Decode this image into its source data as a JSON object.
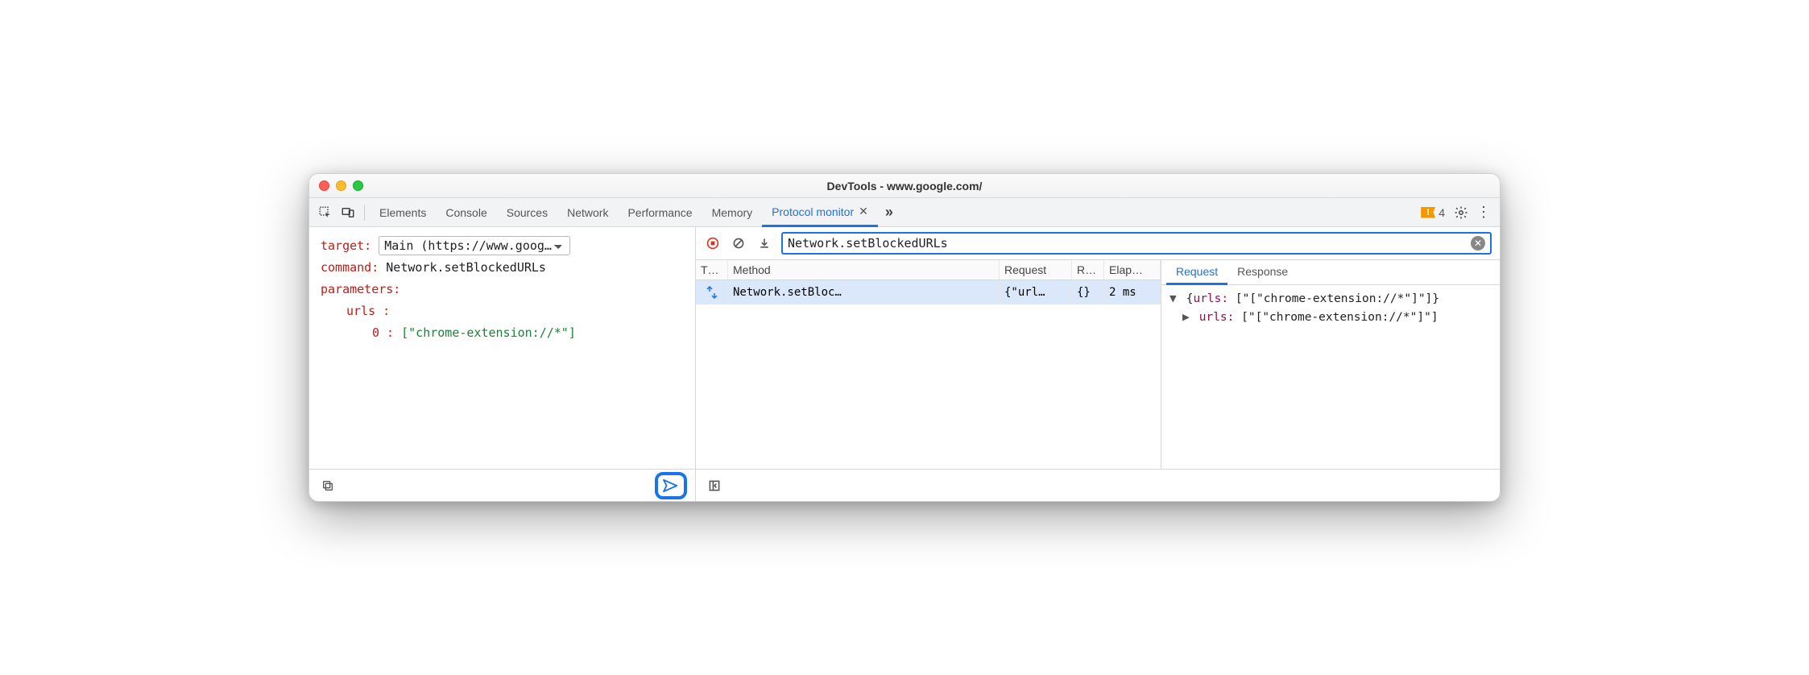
{
  "window": {
    "title": "DevTools - www.google.com/"
  },
  "tabs": {
    "elements": "Elements",
    "console": "Console",
    "sources": "Sources",
    "network": "Network",
    "performance": "Performance",
    "memory": "Memory",
    "protocol_monitor": "Protocol monitor"
  },
  "issues_count": "4",
  "editor": {
    "target_label": "target:",
    "target_value": "Main (https://www.goog…",
    "command_label": "command:",
    "command_value": "Network.setBlockedURLs",
    "parameters_label": "parameters:",
    "urls_label": "urls :",
    "index0_label": "0 :",
    "index0_value": "[\"chrome-extension://*\"]"
  },
  "filter": {
    "value": "Network.setBlockedURLs"
  },
  "table": {
    "headers": {
      "type": "T…",
      "method": "Method",
      "request": "Request",
      "response": "R…",
      "elapsed": "Elap…"
    },
    "rows": [
      {
        "method": "Network.setBloc…",
        "request": "{\"url…",
        "response": "{}",
        "elapsed": "2 ms"
      }
    ]
  },
  "detail": {
    "tab_request": "Request",
    "tab_response": "Response",
    "line1_key": "urls:",
    "line1_val": "[\"[\"chrome-extension://*\"]\"]",
    "line2_key": "urls:",
    "line2_val": "[\"[\"chrome-extension://*\"]\"]"
  }
}
